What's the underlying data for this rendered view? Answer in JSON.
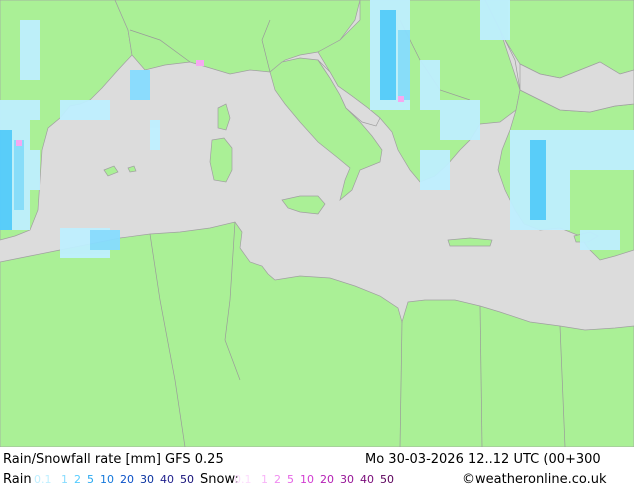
{
  "title": "Rain/Snowfall rate [mm] GFS 0.25",
  "datetime": "Mo 30-03-2026 12..12 UTC (00+300",
  "credit": "©weatheronline.co.uk",
  "legend": {
    "rain_label": "Rain",
    "rain_values": [
      {
        "text": "0.1",
        "color": "#bfefff"
      },
      {
        "text": "1",
        "color": "#87dcff"
      },
      {
        "text": "2",
        "color": "#55ccff"
      },
      {
        "text": "5",
        "color": "#28a8f0"
      },
      {
        "text": "10",
        "color": "#1478dc"
      },
      {
        "text": "20",
        "color": "#0a50c8"
      },
      {
        "text": "30",
        "color": "#0a32a0"
      },
      {
        "text": "40",
        "color": "#1e1e8c"
      },
      {
        "text": "50",
        "color": "#140f78"
      }
    ],
    "snow_label": "Snow:",
    "snow_values": [
      {
        "text": "0.1",
        "color": "#fcdcfc"
      },
      {
        "text": "1",
        "color": "#f8b4f8"
      },
      {
        "text": "2",
        "color": "#f08cf0"
      },
      {
        "text": "5",
        "color": "#e664e6"
      },
      {
        "text": "10",
        "color": "#d23cd2"
      },
      {
        "text": "20",
        "color": "#b41eb4"
      },
      {
        "text": "30",
        "color": "#961496"
      },
      {
        "text": "40",
        "color": "#780a78"
      },
      {
        "text": "50",
        "color": "#5a005a"
      }
    ]
  },
  "colors": {
    "land": "#aaf096",
    "sea": "#dcdcdc",
    "rain_light": "#bfefff",
    "rain_medium": "#55ccff",
    "snow": "#f5a8f0"
  }
}
